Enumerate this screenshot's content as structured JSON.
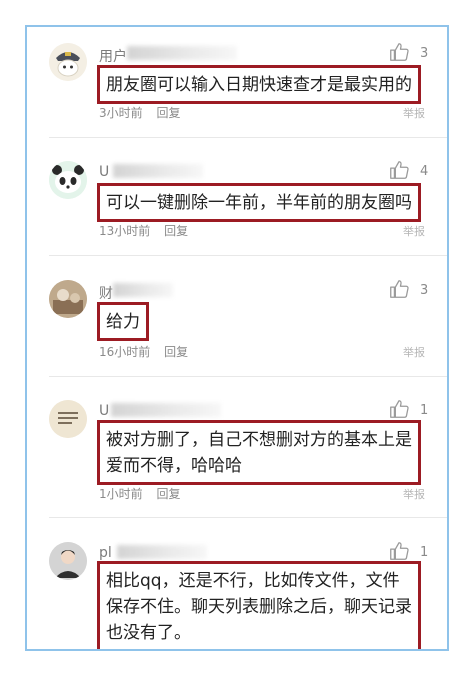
{
  "comments": [
    {
      "username": "用户",
      "likes": "3",
      "text_lines": [
        "朋友圈可以输入日期快速查才是最实用的"
      ],
      "time": "3小时前",
      "reply": "回复",
      "report": "举报"
    },
    {
      "username": "U",
      "likes": "4",
      "text_lines": [
        "可以一键删除一年前，半年前的朋友圈吗"
      ],
      "time": "13小时前",
      "reply": "回复",
      "report": "举报"
    },
    {
      "username": "财",
      "likes": "3",
      "text_lines": [
        "给力"
      ],
      "time": "16小时前",
      "reply": "回复",
      "report": "举报"
    },
    {
      "username": "U",
      "likes": "1",
      "text_lines": [
        "被对方删了，自己不想删对方的基本上是",
        "爱而不得，哈哈哈"
      ],
      "time": "1小时前",
      "reply": "回复",
      "report": "举报"
    },
    {
      "username": "pl",
      "likes": "1",
      "text_lines": [
        "相比qq，还是不行，比如传文件，文件",
        "保存不住。聊天列表删除之后，聊天记录",
        "也没有了。"
      ],
      "time": "",
      "reply": "",
      "report": ""
    }
  ],
  "colors": {
    "frame_border": "#8fc3ea",
    "highlight_border": "#9c1b23",
    "meta_text": "#8a8a8a"
  },
  "icons": {
    "like": "thumbs-up-icon",
    "avatars": [
      "police-cap-avatar",
      "panda-avatar",
      "photo-avatar",
      "note-card-avatar",
      "person-photo-avatar"
    ]
  }
}
